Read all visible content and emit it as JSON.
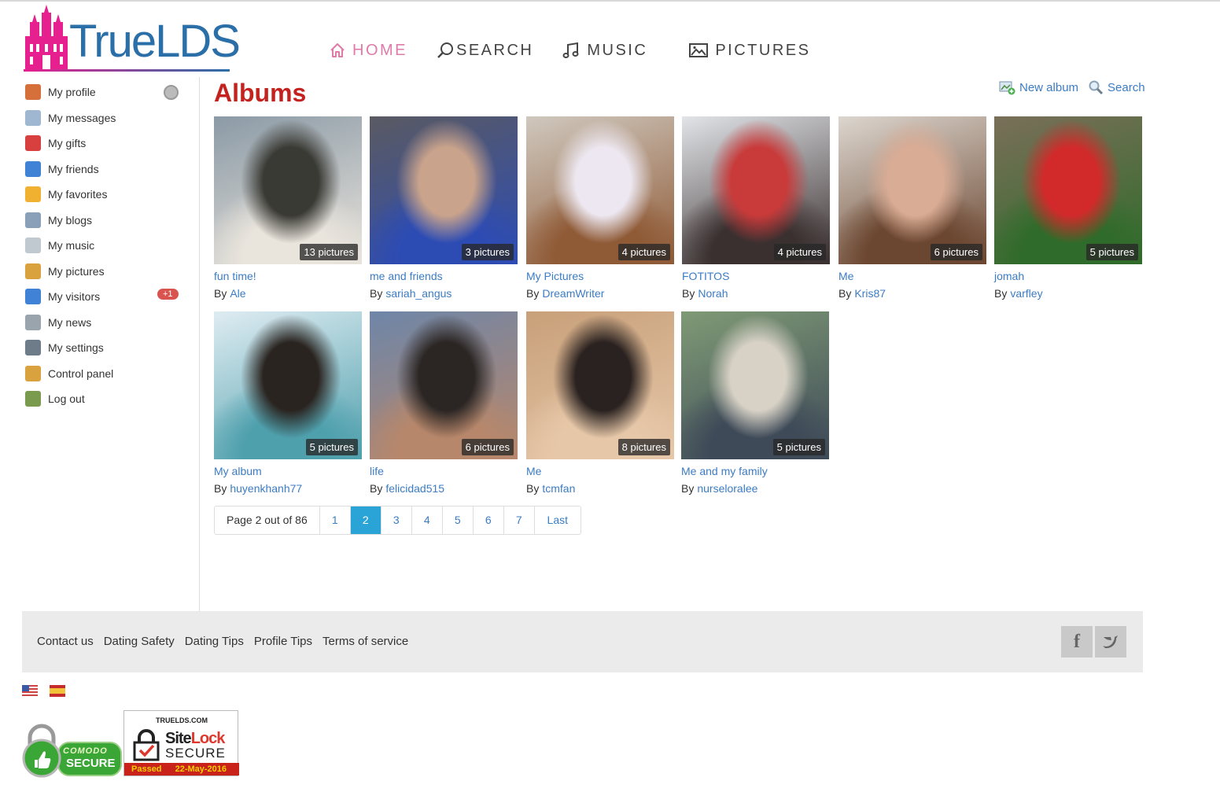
{
  "brand": {
    "logo_text": "TrueLDS"
  },
  "nav": [
    {
      "label": "HOME",
      "icon": "home-icon",
      "active": true
    },
    {
      "label": "SEARCH",
      "icon": "search-icon",
      "active": false
    },
    {
      "label": "MUSIC",
      "icon": "music-note-icon",
      "active": false
    },
    {
      "label": "PICTURES",
      "icon": "picture-icon",
      "active": false
    }
  ],
  "sidebar": {
    "items": [
      {
        "label": "My profile",
        "icon": "house-icon",
        "color": "#d5703a"
      },
      {
        "label": "My messages",
        "icon": "envelope-icon",
        "color": "#9fb7d0"
      },
      {
        "label": "My gifts",
        "icon": "gift-icon",
        "color": "#d84040"
      },
      {
        "label": "My friends",
        "icon": "people-icon",
        "color": "#3f82d6"
      },
      {
        "label": "My favorites",
        "icon": "star-icon",
        "color": "#f0b030"
      },
      {
        "label": "My blogs",
        "icon": "notebook-icon",
        "color": "#8aa0b8"
      },
      {
        "label": "My music",
        "icon": "cd-icon",
        "color": "#c0c8d0"
      },
      {
        "label": "My pictures",
        "icon": "picture-icon",
        "color": "#d9a23e"
      },
      {
        "label": "My visitors",
        "icon": "user-icon",
        "color": "#3f82d6"
      },
      {
        "label": "My news",
        "icon": "newspaper-icon",
        "color": "#9aa4ad"
      },
      {
        "label": "My settings",
        "icon": "settings-icon",
        "color": "#6e7b88"
      },
      {
        "label": "Control panel",
        "icon": "wand-icon",
        "color": "#d9a23e"
      },
      {
        "label": "Log out",
        "icon": "exit-icon",
        "color": "#7a9a4e"
      }
    ],
    "visitors_badge": "+1"
  },
  "content": {
    "title": "Albums",
    "new_album": "New album",
    "search": "Search",
    "by_prefix": "By",
    "albums": [
      {
        "title": "fun time!",
        "author": "Ale",
        "count": "13 pictures",
        "colors": [
          "#8b9aa6",
          "#e9e4dc",
          "#3a3a34"
        ]
      },
      {
        "title": "me and friends",
        "author": "sariah_angus",
        "count": "3 pictures",
        "colors": [
          "#5a5a62",
          "#2d4cb3",
          "#c9a38b"
        ]
      },
      {
        "title": "My Pictures",
        "author": "DreamWriter",
        "count": "4 pictures",
        "colors": [
          "#cfc8be",
          "#8f5a36",
          "#ece7f0"
        ]
      },
      {
        "title": "FOTITOS",
        "author": "Norah",
        "count": "4 pictures",
        "colors": [
          "#e1e4e8",
          "#3b3030",
          "#c93a3a"
        ]
      },
      {
        "title": "Me",
        "author": "Kris87",
        "count": "6 pictures",
        "colors": [
          "#dcd6cf",
          "#6b4630",
          "#d9ac95"
        ]
      },
      {
        "title": "jomah",
        "author": "varfley",
        "count": "5 pictures",
        "colors": [
          "#7a6f59",
          "#2f6b2a",
          "#d22a2a"
        ]
      },
      {
        "title": "My album",
        "author": "huyenkhanh77",
        "count": "5 pictures",
        "colors": [
          "#dfecf2",
          "#4fa0ad",
          "#2a2420"
        ]
      },
      {
        "title": "life",
        "author": "felicidad515",
        "count": "6 pictures",
        "colors": [
          "#6e86a8",
          "#b7876b",
          "#2b2624"
        ]
      },
      {
        "title": "Me",
        "author": "tcmfan",
        "count": "8 pictures",
        "colors": [
          "#c8a07a",
          "#e6c7a8",
          "#2a2220"
        ]
      },
      {
        "title": "Me and my family",
        "author": "nurseloralee",
        "count": "5 pictures",
        "colors": [
          "#7f9a75",
          "#3e4a58",
          "#d8d2c6"
        ]
      }
    ]
  },
  "pagination": {
    "info": "Page 2 out of 86",
    "pages": [
      "1",
      "2",
      "3",
      "4",
      "5",
      "6",
      "7"
    ],
    "current": "2",
    "last": "Last"
  },
  "footer": {
    "links": [
      "Contact us",
      "Dating Safety",
      "Dating Tips",
      "Profile Tips",
      "Terms of service"
    ],
    "social": [
      {
        "name": "facebook-icon",
        "glyph": "f"
      },
      {
        "name": "twitter-icon",
        "glyph": ""
      }
    ]
  },
  "languages": [
    "english-flag",
    "spanish-flag"
  ],
  "badges": {
    "comodo": {
      "line1": "COMODO",
      "line2": "SECURE"
    },
    "sitelock": {
      "domain": "TRUELDS.COM",
      "name_a": "Site",
      "name_b": "Lock",
      "secure": "SECURE",
      "passed": "Passed",
      "date": "22-May-2016"
    }
  }
}
